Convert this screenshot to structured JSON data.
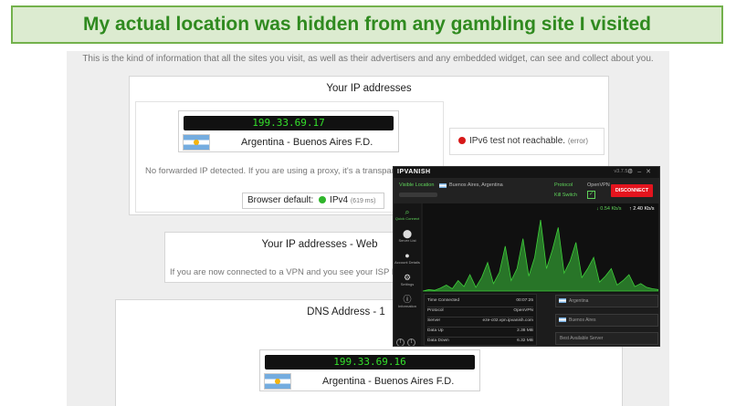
{
  "banner": {
    "title": "My actual location was hidden from any gambling site I visited"
  },
  "page": {
    "intro": "This is the kind of information that all the sites you visit, as well as their advertisers and any embedded widget, can see and collect about you.",
    "ip_section": {
      "title": "Your IP addresses",
      "ip": "199.33.69.17",
      "location": "Argentina - Buenos Aires F.D.",
      "no_forward": "No forwarded IP detected. If you are using a proxy, it's a transparent",
      "browser_default_label": "Browser default:",
      "protocol": "IPv4",
      "latency": "(619 ms)",
      "ipv6_text": "IPv6 test not reachable.",
      "ipv6_error": "(error)"
    },
    "webrtc_section": {
      "title": "Your IP addresses - Web",
      "text": "If you are now connected to a VPN and you see your ISP IP"
    },
    "dns_section": {
      "title": "DNS Address - 1",
      "ip": "199.33.69.16",
      "location": "Argentina - Buenos Aires F.D."
    }
  },
  "vpn": {
    "logo": "IPVANISH",
    "version": "v3.7.5.7",
    "visible_location_label": "Visible Location",
    "visible_location_value": "Buenos Aires, Argentina",
    "protocol_label": "Protocol",
    "protocol_value": "OpenVPN",
    "kill_switch_label": "Kill Switch",
    "disconnect_label": "DISCONNECT",
    "sidebar": [
      {
        "label": "Quick Connect",
        "icon": "search-icon"
      },
      {
        "label": "Server List",
        "icon": "location-pin-icon"
      },
      {
        "label": "Account Details",
        "icon": "user-icon"
      },
      {
        "label": "Settings",
        "icon": "gear-icon"
      },
      {
        "label": "Information",
        "icon": "info-icon"
      }
    ],
    "download_speed": "0.54 Kb/s",
    "upload_speed": "2.40 Kb/s",
    "stats": [
      {
        "label": "Time Connected",
        "value": "00:07:25"
      },
      {
        "label": "Protocol",
        "value": "OpenVPN"
      },
      {
        "label": "Server",
        "value": "eze-c02.vpn.ipvanish.com"
      },
      {
        "label": "Data Up",
        "value": "2.38 MB"
      },
      {
        "label": "Data Down",
        "value": "6.32 MB"
      }
    ],
    "country_select": "Argentina",
    "city_select": "Buenos Aires",
    "server_select": "Best Available Server",
    "colors": {
      "accent": "#5fd35a",
      "disconnect": "#e4141e"
    },
    "graph_download": [
      0,
      2,
      1,
      4,
      8,
      3,
      14,
      6,
      22,
      5,
      18,
      38,
      10,
      25,
      60,
      14,
      30,
      70,
      20,
      45,
      95,
      30,
      55,
      85,
      24,
      40,
      65,
      18,
      30,
      45,
      12,
      20,
      30,
      8,
      14,
      22,
      6,
      10,
      5,
      3,
      2
    ]
  }
}
